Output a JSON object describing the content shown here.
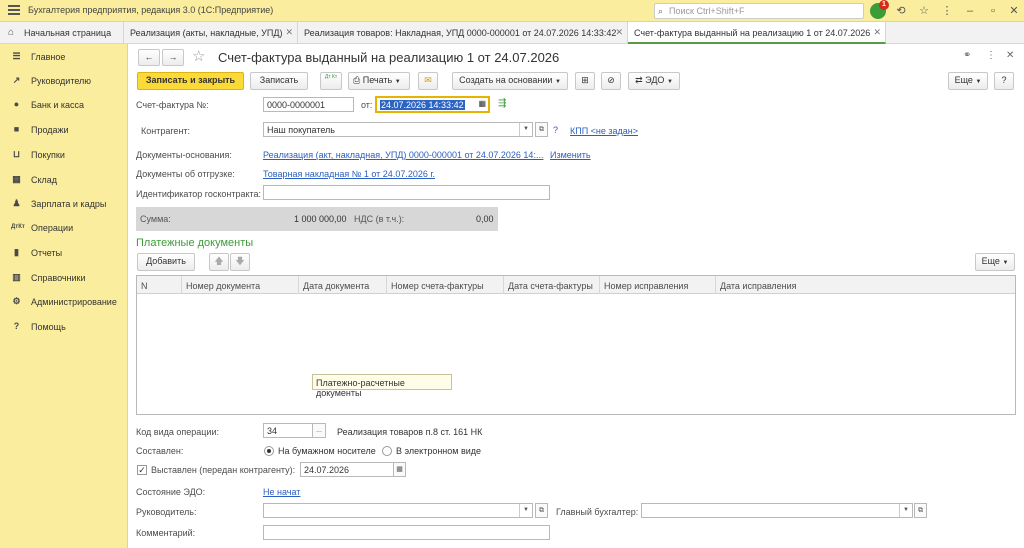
{
  "titlebar": {
    "title": "Бухгалтерия предприятия, редакция 3.0  (1С:Предприятие)",
    "search_placeholder": "Поиск Ctrl+Shift+F",
    "notification_count": "1"
  },
  "tabs": [
    {
      "label": "Начальная страница"
    },
    {
      "label": "Реализация (акты, накладные, УПД)"
    },
    {
      "label": "Реализация товаров: Накладная, УПД 0000-000001 от 24.07.2026 14:33:42"
    },
    {
      "label": "Счет-фактура выданный на реализацию 1 от 24.07.2026"
    }
  ],
  "sidebar": {
    "items": [
      {
        "label": "Главное",
        "icon": "menu-icon"
      },
      {
        "label": "Руководителю",
        "icon": "trend-icon"
      },
      {
        "label": "Банк и касса",
        "icon": "coin-icon"
      },
      {
        "label": "Продажи",
        "icon": "bag-icon"
      },
      {
        "label": "Покупки",
        "icon": "cart-icon"
      },
      {
        "label": "Склад",
        "icon": "warehouse-icon"
      },
      {
        "label": "Зарплата и кадры",
        "icon": "people-icon"
      },
      {
        "label": "Операции",
        "icon": "operations-icon"
      },
      {
        "label": "Отчеты",
        "icon": "reports-icon"
      },
      {
        "label": "Справочники",
        "icon": "books-icon"
      },
      {
        "label": "Администрирование",
        "icon": "gear-icon"
      },
      {
        "label": "Помощь",
        "icon": "help-icon"
      }
    ]
  },
  "form": {
    "title": "Счет-фактура выданный на реализацию 1 от 24.07.2026",
    "toolbar": {
      "save_close": "Записать и закрыть",
      "save": "Записать",
      "dt_kt": "Дт Кт",
      "print": "Печать",
      "create_based": "Создать на основании",
      "edo": "ЭДО",
      "more": "Еще"
    },
    "invoice_label": "Счет-фактура №:",
    "invoice_number": "0000-0000001",
    "from_label": "от:",
    "invoice_date": "24.07.2026 14:33:42",
    "counterparty_label": "Контрагент:",
    "counterparty_value": "Наш покупатель",
    "kpp_link": "КПП <не задан>",
    "basis_label": "Документы-основания:",
    "basis_link": "Реализация (акт, накладная, УПД) 0000-000001 от 24.07.2026 14:...",
    "change_link": "Изменить",
    "shipment_label": "Документы об отгрузке:",
    "shipment_link": "Товарная накладная № 1 от 24.07.2026 г.",
    "goscontract_label": "Идентификатор госконтракта:",
    "sum_label": "Сумма:",
    "sum_value": "1 000 000,00",
    "vat_label": "НДС (в т.ч.):",
    "vat_value": "0,00",
    "payments_title": "Платежные документы",
    "add_button": "Добавить",
    "more_button": "Еще",
    "grid_columns": [
      "N",
      "Номер документа",
      "Дата документа",
      "Номер счета-фактуры",
      "Дата счета-фактуры",
      "Номер исправления",
      "Дата исправления"
    ],
    "tooltip": "Платежно-расчетные документы",
    "op_code_label": "Код вида операции:",
    "op_code_value": "34",
    "op_code_desc": "Реализация товаров п.8 ст. 161 НК",
    "composed_label": "Составлен:",
    "radio_paper": "На бумажном носителе",
    "radio_electronic": "В электронном виде",
    "issued_label": "Выставлен (передан контрагенту):",
    "issued_date": "24.07.2026",
    "edo_state_label": "Состояние ЭДО:",
    "edo_state_link": "Не начат",
    "manager_label": "Руководитель:",
    "chief_accountant_label": "Главный бухгалтер:",
    "comment_label": "Комментарий:"
  }
}
